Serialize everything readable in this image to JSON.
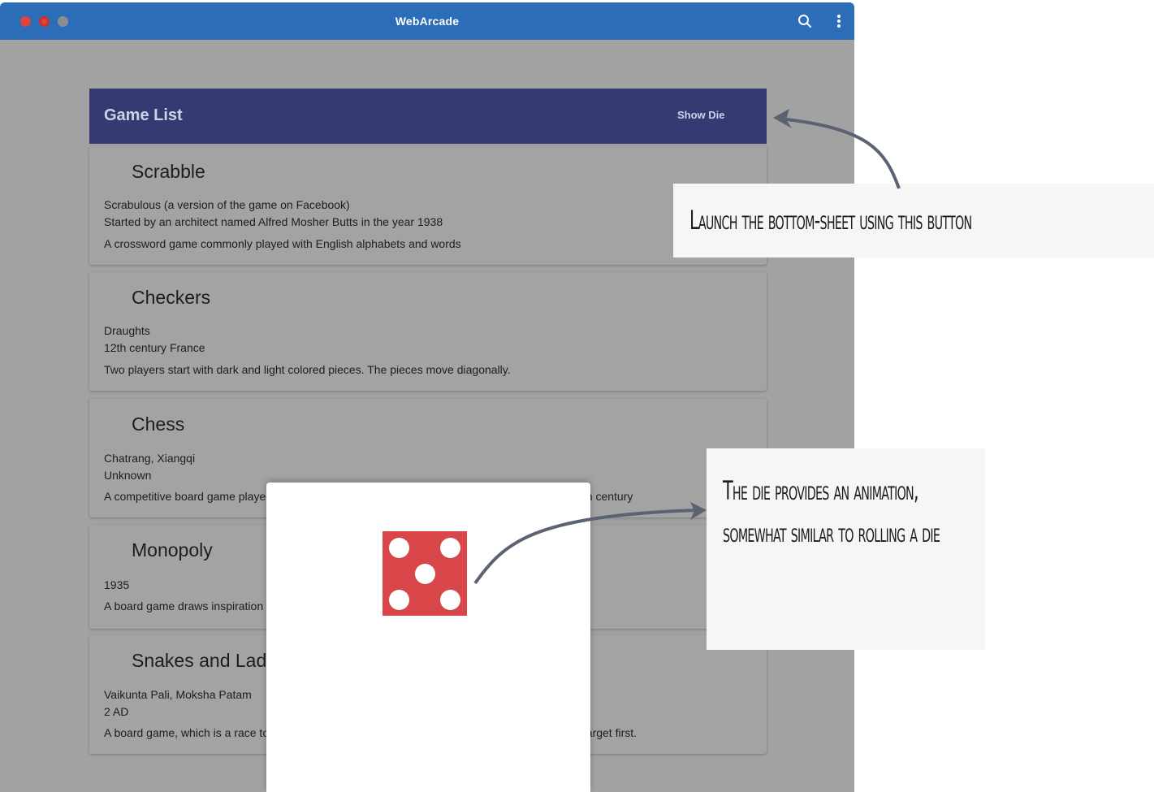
{
  "window": {
    "title": "WebArcade"
  },
  "toolbar": {
    "search_icon": "search-icon",
    "menu_icon": "more-vert-icon"
  },
  "game_list": {
    "title": "Game List",
    "show_die_label": "Show Die",
    "games": [
      {
        "name": "Scrabble",
        "lines": [
          "Scrabulous (a version of the game on Facebook)",
          "Started by an architect named Alfred Mosher Butts in the year 1938",
          "A crossword game commonly played with English alphabets and words"
        ]
      },
      {
        "name": "Checkers",
        "lines": [
          "Draughts",
          "12th century France",
          "Two players start with dark and light colored pieces. The pieces move diagonally."
        ]
      },
      {
        "name": "Chess",
        "lines": [
          "Chatrang, Xiangqi",
          "Unknown",
          "A competitive board game played between two players. Originated as a game played in India, 6th century"
        ]
      },
      {
        "name": "Monopoly",
        "lines": [
          "1935",
          "A board game draws inspiration from the landlord's game"
        ]
      },
      {
        "name": "Snakes and Ladders",
        "lines": [
          "Vaikunta Pali, Moksha Patam",
          "2 AD",
          "A board game, which is a race to reach the end. Players move tokens on a board, reaching the target first."
        ]
      }
    ]
  },
  "bottom_sheet": {
    "die_face": 5,
    "die_color": "#d9464a"
  },
  "annotations": {
    "callout_1": "Launch the bottom-sheet using this button",
    "callout_2": "The die provides an animation, somewhat similar to rolling a die"
  }
}
